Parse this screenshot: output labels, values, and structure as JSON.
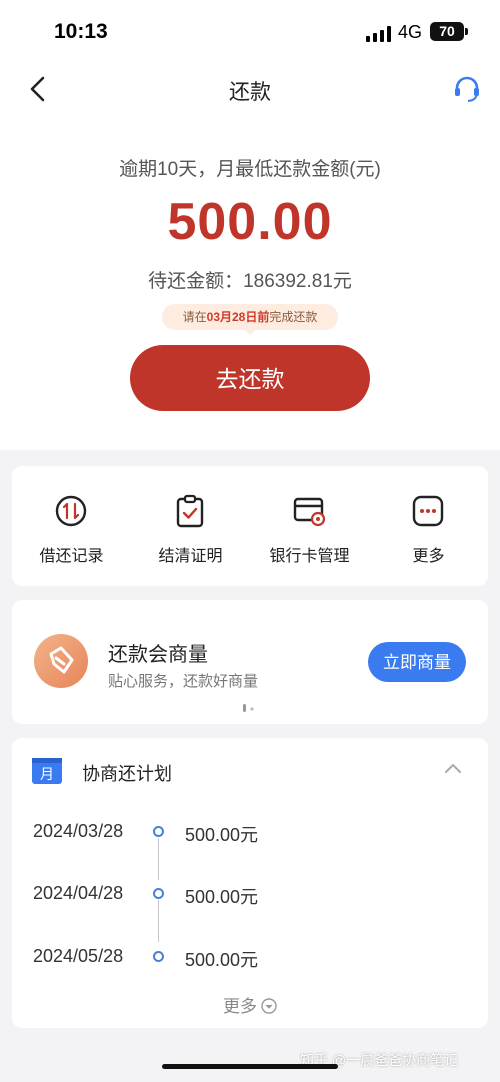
{
  "status_bar": {
    "time": "10:13",
    "network": "4G",
    "battery": "70"
  },
  "header": {
    "title": "还款"
  },
  "summary": {
    "overdue_text": "逾期10天，月最低还款金额(元)",
    "min_amount": "500.00",
    "pending_label": "待还金额：",
    "pending_amount": "186392.81元",
    "deadline_prefix": "请在",
    "deadline_date": "03月28日前",
    "deadline_suffix": "完成还款",
    "repay_button": "去还款"
  },
  "quick_actions": [
    {
      "label": "借还记录",
      "icon": "arrows-updown-icon"
    },
    {
      "label": "结清证明",
      "icon": "clipboard-check-icon"
    },
    {
      "label": "银行卡管理",
      "icon": "card-settings-icon"
    },
    {
      "label": "更多",
      "icon": "more-dots-icon"
    }
  ],
  "negotiate": {
    "title": "还款会商量",
    "subtitle": "贴心服务，还款好商量",
    "button": "立即商量"
  },
  "plan": {
    "title": "协商还计划",
    "calendar_char": "月",
    "rows": [
      {
        "date": "2024/03/28",
        "amount": "500.00元"
      },
      {
        "date": "2024/04/28",
        "amount": "500.00元"
      },
      {
        "date": "2024/05/28",
        "amount": "500.00元"
      }
    ],
    "more_label": "更多"
  },
  "watermark": "知乎 @一晨爸爸协商笔记",
  "colors": {
    "accent_red": "#c0352a",
    "accent_blue": "#3a7bf0"
  }
}
